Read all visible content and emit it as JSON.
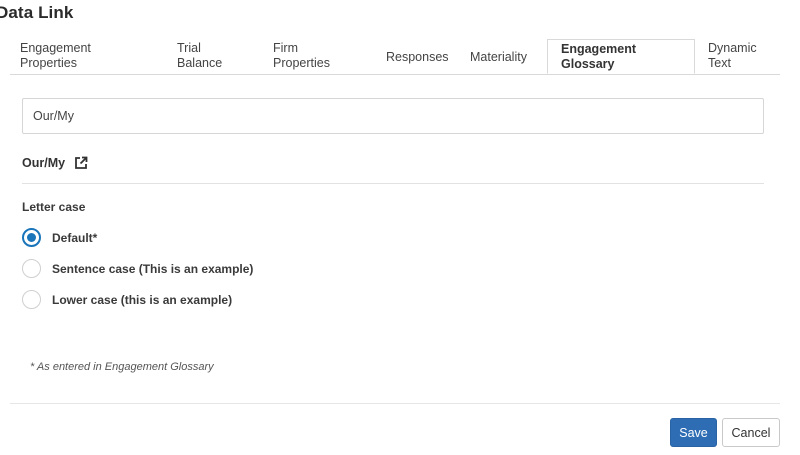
{
  "dialog": {
    "title": "Data Link"
  },
  "tabs": [
    {
      "line1": "Engagement",
      "line2": "Properties",
      "active": false
    },
    {
      "line1": "Trial",
      "line2": "Balance",
      "active": false
    },
    {
      "line1": "Firm",
      "line2": "Properties",
      "active": false
    },
    {
      "line1": "Responses",
      "line2": "",
      "active": false
    },
    {
      "line1": "Materiality",
      "line2": "",
      "active": false
    },
    {
      "line1": "Engagement",
      "line2": "Glossary",
      "active": true
    },
    {
      "line1": "Dynamic",
      "line2": "Text",
      "active": false
    }
  ],
  "search": {
    "value": "Our/My",
    "placeholder": ""
  },
  "term": {
    "label": "Our/My",
    "icon": "external-link-icon"
  },
  "letter_case": {
    "label": "Letter case",
    "options": [
      {
        "label": "Default*",
        "selected": true
      },
      {
        "label": "Sentence case (This is an example)",
        "selected": false
      },
      {
        "label": "Lower case (this is an example)",
        "selected": false
      }
    ]
  },
  "footnote": "* As entered in Engagement Glossary",
  "buttons": {
    "save": "Save",
    "cancel": "Cancel"
  },
  "colors": {
    "accent": "#1a75bb",
    "save_button": "#2e6db4"
  }
}
